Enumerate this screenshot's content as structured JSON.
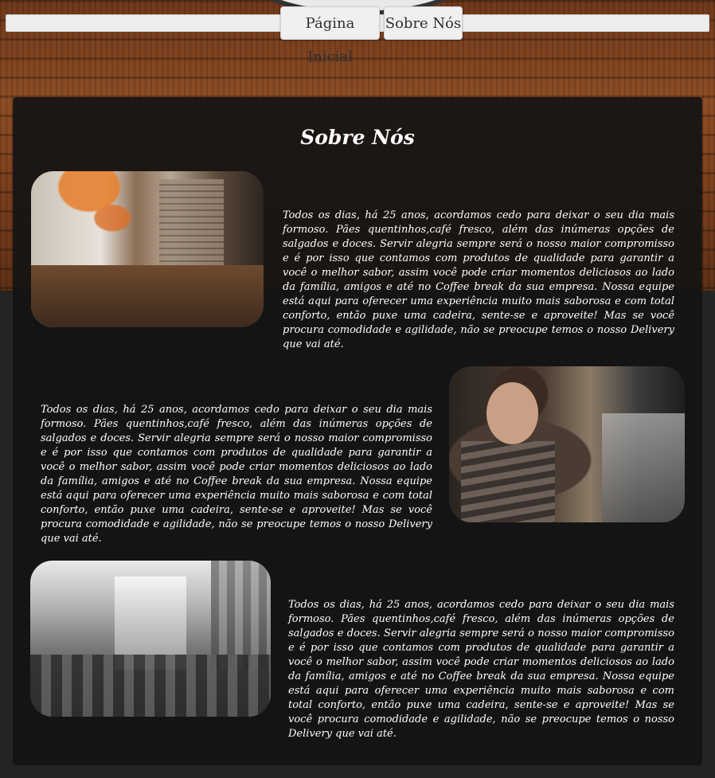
{
  "nav": {
    "home_label": "Página Inicial",
    "about_label": "Sobre Nós"
  },
  "section": {
    "title": "Sobre Nós",
    "blocks": [
      {
        "text": "Todos os dias, há 25 anos, acordamos cedo para deixar o seu dia mais formoso. Pães quentinhos,café fresco, além das inúmeras opções de salgados e doces. Servir alegria sempre será o nosso maior compromisso e é por isso que contamos com produtos de qualidade para garantir a você o melhor sabor, assim você pode criar momentos deliciosos ao lado da família, amigos e até no Coffee break da sua empresa. Nossa equipe está aqui para oferecer uma experiência muito mais saborosa e com total conforto, então puxe uma cadeira, sente-se e aproveite! Mas se você procura comodidade e agilidade, não se preocupe temos o nosso Delivery que vai até."
      },
      {
        "text": "Todos os dias, há 25 anos, acordamos cedo para deixar o seu dia mais formoso. Pães quentinhos,café fresco, além das inúmeras opções de salgados e doces. Servir alegria sempre será o nosso maior compromisso e é por isso que contamos com produtos de qualidade para garantir a você o melhor sabor, assim você pode criar momentos deliciosos ao lado da família, amigos e até no Coffee break da sua empresa. Nossa equipe está aqui para oferecer uma experiência muito mais saborosa e com total conforto, então puxe uma cadeira, sente-se e aproveite! Mas se você procura comodidade e agilidade, não se preocupe temos o nosso Delivery que vai até."
      },
      {
        "text": "Todos os dias, há 25 anos, acordamos cedo para deixar o seu dia mais formoso. Pães quentinhos,café fresco, além das inúmeras opções de salgados e doces. Servir alegria sempre será o nosso maior compromisso e é por isso que contamos com produtos de qualidade para garantir a você o melhor sabor, assim você pode criar momentos deliciosos ao lado da família, amigos e até no Coffee break da sua empresa. Nossa equipe está aqui para oferecer uma experiência muito mais saborosa e com total conforto, então puxe uma cadeira, sente-se e aproveite! Mas se você procura comodidade e agilidade, não se preocupe temos o nosso Delivery que vai até."
      }
    ]
  },
  "colors": {
    "wood": "#7b3e1b",
    "panel": "#141414",
    "page_bg": "#242424",
    "text": "#ffffff",
    "nav_bg": "#eeeeee"
  }
}
